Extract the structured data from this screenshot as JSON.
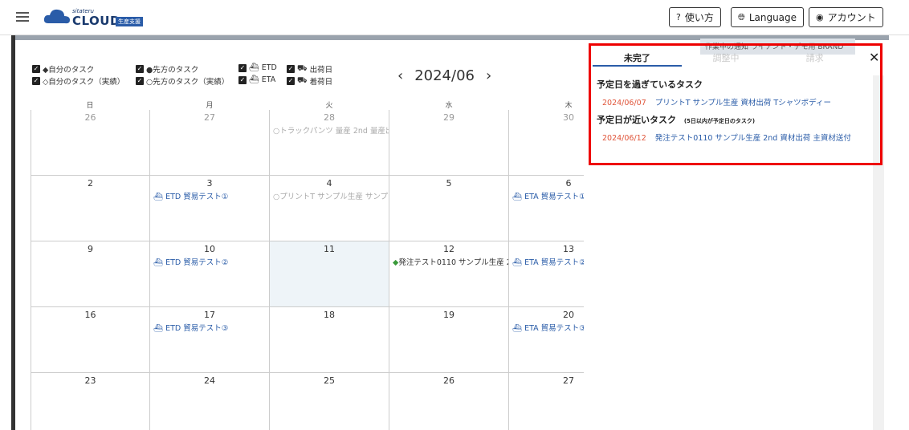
{
  "header": {
    "logo_small": "sitateru",
    "logo_big": "CLOUD",
    "logo_tag": "生産支援",
    "help_label": "使い方",
    "language_label": "Language",
    "account_label": "アカウント"
  },
  "filters": {
    "my_task": "◆自分のタスク",
    "my_task_done": "◇自分のタスク（実績）",
    "their_task": "●先方のタスク",
    "their_task_done": "○先方のタスク（実績）",
    "etd": "ETD",
    "eta": "ETA",
    "ship": "出荷日",
    "arrive": "着荷日"
  },
  "calendar": {
    "month": "2024/06",
    "days_of_week": [
      "日",
      "月",
      "火",
      "水",
      "木"
    ],
    "weeks": [
      [
        {
          "num": "26",
          "events": []
        },
        {
          "num": "27",
          "events": []
        },
        {
          "num": "28",
          "events": [
            "○トラックパンツ 量産 2nd 量産出"
          ]
        },
        {
          "num": "29",
          "events": []
        },
        {
          "num": "30",
          "events": []
        }
      ],
      [
        {
          "num": "2",
          "events": []
        },
        {
          "num": "3",
          "events": [
            "ETD 貿易テスト①"
          ]
        },
        {
          "num": "4",
          "events": [
            "○プリントT サンプル生産 サンプ"
          ]
        },
        {
          "num": "5",
          "events": []
        },
        {
          "num": "6",
          "events": [
            "ETA 貿易テスト①"
          ]
        }
      ],
      [
        {
          "num": "9",
          "events": []
        },
        {
          "num": "10",
          "events": [
            "ETD 貿易テスト②"
          ]
        },
        {
          "num": "11",
          "events": []
        },
        {
          "num": "12",
          "events": [
            "◆発注テスト0110 サンプル生産 2"
          ]
        },
        {
          "num": "13",
          "events": [
            "ETA 貿易テスト②"
          ]
        }
      ],
      [
        {
          "num": "16",
          "events": []
        },
        {
          "num": "17",
          "events": [
            "ETD 貿易テスト③"
          ]
        },
        {
          "num": "18",
          "events": []
        },
        {
          "num": "19",
          "events": []
        },
        {
          "num": "20",
          "events": [
            "ETA 貿易テスト③"
          ]
        }
      ],
      [
        {
          "num": "23",
          "events": []
        },
        {
          "num": "24",
          "events": []
        },
        {
          "num": "25",
          "events": []
        },
        {
          "num": "26",
          "events": []
        },
        {
          "num": "27",
          "events": []
        }
      ]
    ]
  },
  "panel": {
    "tabs": [
      "未完了",
      "調整中",
      "請求"
    ],
    "overlap_text": "作業中の通知  ライアント・デモ用 BRAND",
    "overdue_title": "予定日を過ぎているタスク",
    "overdue_date": "2024/06/07",
    "overdue_text": "プリントT サンプル生産 資材出荷 Tシャツボディー",
    "upcoming_title": "予定日が近いタスク",
    "upcoming_sub": "(5日以内が予定日のタスク)",
    "upcoming_date": "2024/06/12",
    "upcoming_text": "発注テスト0110 サンプル生産 2nd 資材出荷 主資材送付"
  },
  "colors": {
    "accent": "#2a5ca8",
    "overdue": "#e0553a",
    "highlight": "#ee0000"
  }
}
